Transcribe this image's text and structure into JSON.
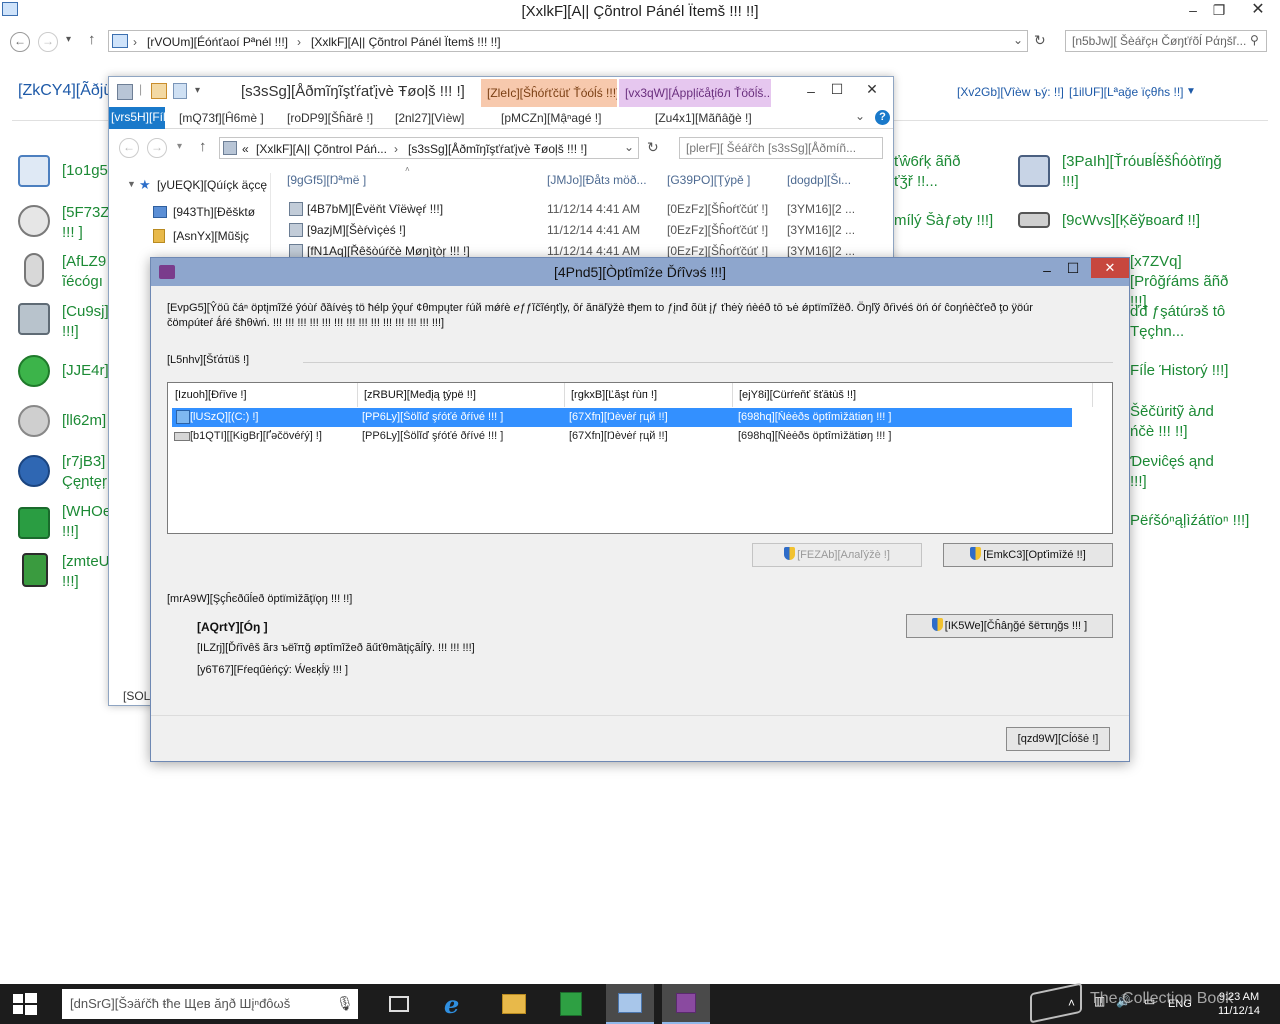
{
  "control_panel": {
    "window_title": "[XxlkF][A|| Çõntrol Pánél Ïtemš !!! !!]",
    "breadcrumb": [
      "[rVOUm][Éóńťaoí Pªnél !!!]",
      "[XxlkF][A|| Çõntrol Pánél Ïtemš !!! !!]"
    ],
    "search_placeholder": "[n5bJw][ Šèářçн Čøŋťŕõĺ Ράŋšľ...",
    "heading": "[ZkCY4][Ãðjü",
    "view_by_label": "[Xv2Gb][Vîèw ъý: !!]",
    "view_by_value": "[1ilUF][Lªaǧe їçθɦs !!]",
    "items_left": [
      "[1o1g5",
      "[5F73Z\n!!! ]",
      "[AfLZ9\nĩécógı",
      "[Cu9sj]\n!!!]",
      "[JJE4r]",
      "[ll62m]",
      "[r7jB3]\nÇęɲtęŗ",
      "[WHOe\n!!!]",
      "[zmteU\n!!!]"
    ],
    "items_mid": [
      "ťŵ6ŕķ ãñð\nťǯř !!...",
      "mílý Šàƒəty !!!]",
      "",
      "ďđ ƒşátúrэš tô\nTęçhn...",
      "Fíĺe Ήistorý !!!]",
      "Šěčüritỹ àлd\nńčè !!! !!]",
      "Ɗeνiĉęś ąnd\n!!!]",
      "Рëŕšóⁿąļìźátïoⁿ !!!]"
    ],
    "items_right": [
      "[3PaIh][Ťróuвĺěšĥóòtïŋğ\n!!!]",
      "[9cWvs][Ķĕўвoarđ !!]",
      "[x7ZVq][Ρrôğŕáms ãñð\n!!!]"
    ]
  },
  "explorer": {
    "title": "[s3sSg][Åðmĩŋĩşťŕaťįvè Ŧøoļš !!! !]",
    "context_tabs": [
      "[ZleIc][Šĥóŕťčüť Ťóóĺś !!!]",
      "[vx3qW][Áppļίčåţί6л Ťöõĺš..."
    ],
    "ribbon_tabs": [
      "[vrs5H][Fílê",
      "[mQ73f][Ĥ6mè ]",
      "[roDP9][Šĥărê !]",
      "[2nl27][Vìèw]",
      "[pMCZn][Mậⁿagé !]",
      "[Zu4x1][Mãñâğè !]"
    ],
    "address_crumbs": [
      "[XxlkF][A|| Çõntrol Páń...",
      "[s3sSg][Åðmĩŋĩşťŕaťįvè Ŧøoļš !!! !]"
    ],
    "search_placeholder": "[plerF][ Šéářĉh [s3sSg][Åðmíñ...",
    "nav_items": [
      "[yUEQK][Qúíçk äçcę",
      "[943Th][Ðĕšktø",
      "[AsnYx][Mũšįç"
    ],
    "columns": [
      "[9gGf5][Ŋªmë ]",
      "[JMJo][Ðåtз möð...",
      "[G39PO][Ţýpě ]",
      "[dogdp][Šι..."
    ],
    "rows": [
      {
        "name": "[4B7bM][Ēvëňt Vîëẁęŕ !!!]",
        "date": "11/12/14 4:41 AM",
        "type": "[0EzFz][Šĥoŕťčúť !]",
        "size": "[3YM16][2 ..."
      },
      {
        "name": "[9azjM][Šèŕvìçėś !]",
        "date": "11/12/14 4:41 AM",
        "type": "[0EzFz][Šĥoŕťčúť !]",
        "size": "[3YM16][2 ..."
      },
      {
        "name": "[fN1Aq][Řêšòúŕčè Μøŋìţòŗ !!! !]",
        "date": "11/12/14 4:41 AM",
        "type": "[0EzFz][Šĥoŕťčúť !]",
        "size": "[3YM16][2 ..."
      }
    ],
    "status": "[SOLS"
  },
  "dialog": {
    "title": "[4Pnd5][Òptîmîźe Ďŕîvэś !!!]",
    "description": "[EvpG5][Ŷöū čáⁿ öptįmĩžé ŷóùŕ ðȁívėş tö ħélp ŷǫuŕ ¢θmpųter ŕúй mǿŕè ℯƒƒĭčĩéŋťļу, ǒŕ ăпäľÿžè ŧђem to ƒįnđ õüŧ įƒ ťhėỳ ńèéð tō ъė ǿptïmĩžёð. Öŋľў ðŕìνéś öń óŕ ĉοŋńèčťеð ţo ÿöúr čömρúŧеŕ ǻŕé šħθẁń. !!! !!! !!! !!! !!! !!! !!! !!! !!! !!! !!! !!! !!! !!!]",
    "status_label": "[L5nhv][Šťάτüš !]",
    "columns": [
      "[Izuoh][Ðŕīve !]",
      "[zRBUR][Međįą ţýpë !!]",
      "[rgkxB][Ľăşt ŕùп !]",
      "[ejY8i][Cürŕeňť šťāŧùš !!]"
    ],
    "drives": [
      {
        "drive": "[lUSzQ][(C:) !]",
        "media": "[PP6Ly][Šöĺĭď şŕóťé ðŕíνé !!! ]",
        "last_run": "[67Xfn][Ŋèνėŕ ŗцй !!]",
        "status": "[698hq][Ňėėðs öptîmìžätiøŋ !!! ]",
        "selected": true
      },
      {
        "drive": "[b1QTI][[KigBr][Ґəčövéŕý] !]",
        "media": "[PP6Ly][Šöĺĭď şŕóťé ðŕíνé !!! ]",
        "last_run": "[67Xfn][Ŋèνėŕ ŗцй !!]",
        "status": "[698hq][Ňėėðs öptîmìžätiøŋ !!! ]",
        "selected": false
      }
    ],
    "analyze_label": "[FEZAb][Aлаľýžè !]",
    "optimize_label": "[EmkC3][Opťimīžé !!]",
    "scheduled_label": "[mrA9W][Şçĥєðűĺеð öptïmìžãţïǫŋ !!! !!]",
    "scheduled_state": "[AQrtY][Óŋ ]",
    "scheduled_desc": "[ILZrj][Ďŕîvêš ãгз ъëĩπğ øptîmĩžеð ãűťθmȁtįçãĺľŷ. !!! !!! !!!]",
    "frequency": "[y6T67][Fŕеqűėńçý: Ẃeεķĺÿ !!! ]",
    "change_settings_label": "[IK5We][Čĥâŋğé šёττιŋğs !!! ]",
    "close_label": "[qzd9W][Cĺóšė !]"
  },
  "taskbar": {
    "search_placeholder": "[dnSrG][Šэäŕčħ ŧħе Щев ăŋð Шįⁿđôωš",
    "lang": "ENG",
    "time": "9:23 AM",
    "date": "11/12/14",
    "watermark": "The Collection Book"
  },
  "colors": {
    "link_green": "#1c8a35",
    "link_blue": "#1e5aa8",
    "selection": "#3390ff",
    "dialog_title": "#8ea6cd",
    "close_red": "#c7473e",
    "taskbar": "#1c1c1c"
  }
}
